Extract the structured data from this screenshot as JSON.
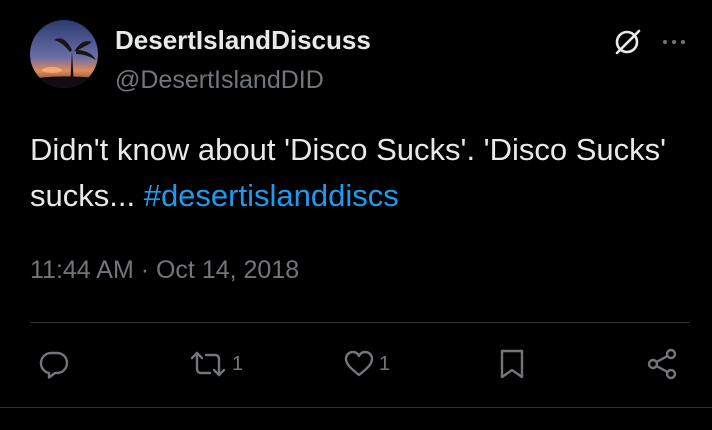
{
  "author": {
    "display_name": "DesertIslandDiscuss",
    "handle": "@DesertIslandDID"
  },
  "tweet": {
    "text": "Didn't know about 'Disco Sucks'. 'Disco Sucks' sucks... ",
    "hashtag": "#desertislanddiscs",
    "timestamp": "11:44 AM · Oct 14, 2018"
  },
  "actions": {
    "retweet_count": "1",
    "like_count": "1"
  },
  "icons": {
    "header": [
      "grok-icon",
      "more-icon"
    ],
    "actions": [
      "reply-icon",
      "retweet-icon",
      "like-icon",
      "bookmark-icon",
      "share-icon"
    ]
  },
  "colors": {
    "background": "#000000",
    "primary_text": "#e7e9ea",
    "secondary_text": "#71767b",
    "link": "#1d9bf0",
    "divider": "#2f3336"
  }
}
